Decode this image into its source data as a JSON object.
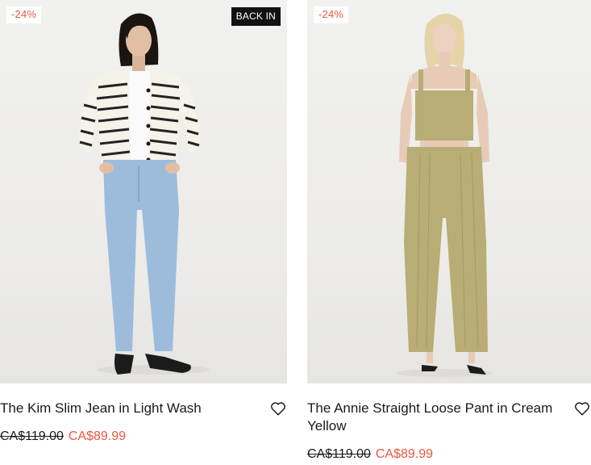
{
  "products": [
    {
      "discount_badge": "-24%",
      "status_badge": "BACK IN",
      "title": "The Kim Slim Jean in Light Wash",
      "price_original": "CA$119.00",
      "price_sale": "CA$89.99",
      "wishlist_icon": "heart-outline-icon"
    },
    {
      "discount_badge": "-24%",
      "title": "The Annie Straight Loose Pant in Cream Yellow",
      "price_original": "CA$119.00",
      "price_sale": "CA$89.99",
      "wishlist_icon": "heart-outline-icon"
    }
  ],
  "colors": {
    "sale": "#e9573f",
    "badge_dark": "#111111",
    "photo_bg": "#efeeec"
  }
}
